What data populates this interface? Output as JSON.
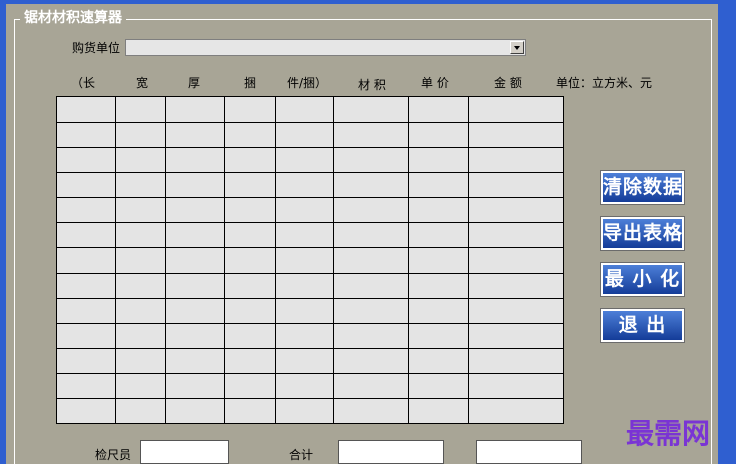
{
  "app": {
    "title": "锯材材积速算器"
  },
  "purchase": {
    "label": "购货单位",
    "value": ""
  },
  "table": {
    "headers": [
      "（长",
      "宽",
      "厚",
      "捆",
      "件/捆）",
      "材 积",
      "单 价",
      "金 额"
    ],
    "unit_note": "单位：立方米、元",
    "rows": 13
  },
  "buttons": {
    "clear": "清除数据",
    "export": "导出表格",
    "minimize": "最 小 化",
    "exit": "退 出"
  },
  "footer": {
    "inspector_label": "检尺员",
    "total_label": "合计"
  },
  "watermark": "最需网",
  "colors": {
    "frame": "#2f5fd0",
    "background": "#a8a596",
    "button": "#1f4aa8",
    "grid": "#e4e4e4",
    "watermark": "#7a34d4"
  }
}
